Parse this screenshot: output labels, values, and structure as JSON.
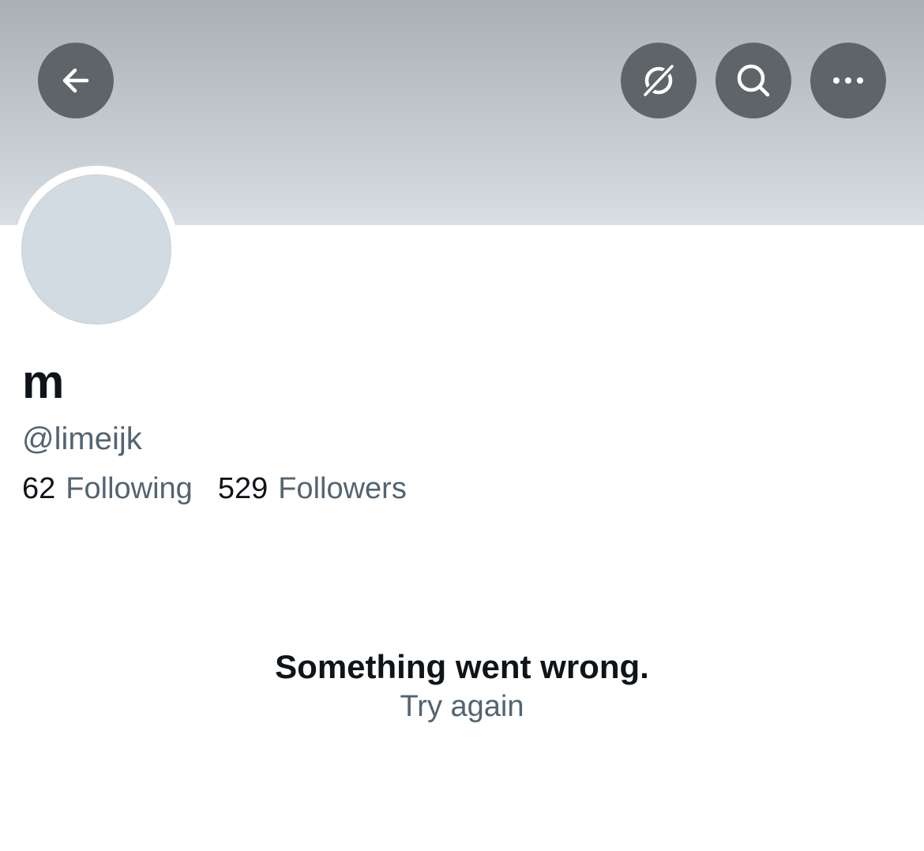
{
  "header": {
    "back_icon": "arrow-left-icon",
    "unfollow_icon": "unfollow-slash-icon",
    "search_icon": "search-icon",
    "more_icon": "more-horizontal-icon",
    "banner_colors": [
      "#a9b1b7",
      "#d8dee2"
    ],
    "button_color": "#5e6467"
  },
  "profile": {
    "display_name": "m",
    "handle": "@limeijk",
    "following_count": "62",
    "following_label": "Following",
    "followers_count": "529",
    "followers_label": "Followers"
  },
  "error": {
    "message": "Something went wrong.",
    "retry_label": "Try again"
  },
  "colors": {
    "text_primary": "#0f1419",
    "text_secondary": "#536471",
    "avatar_placeholder": "#d2dbe1"
  }
}
